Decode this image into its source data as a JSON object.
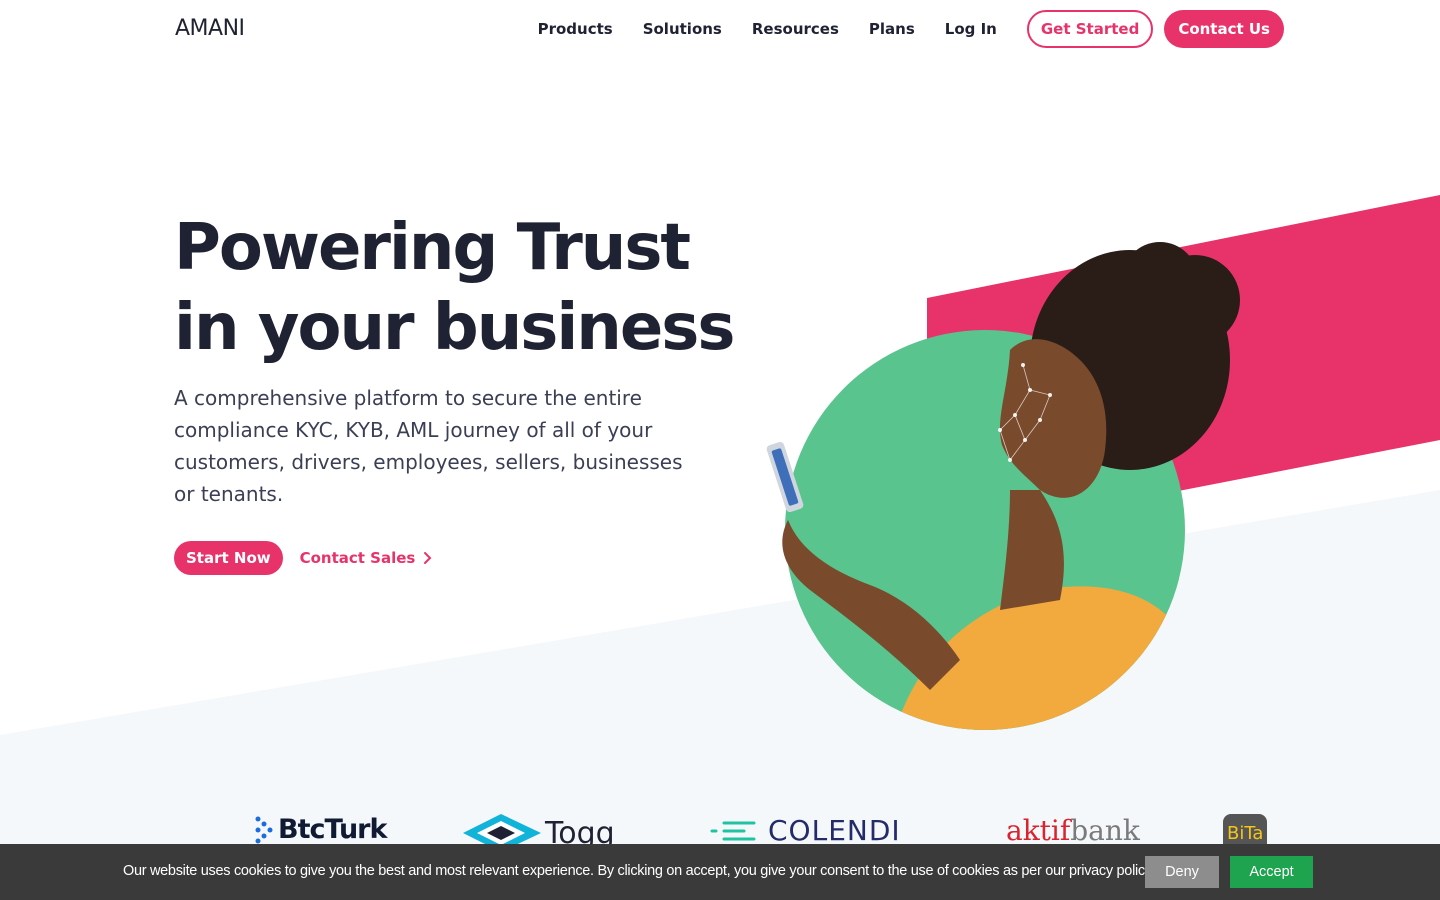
{
  "brand": {
    "logo_text": "AMANI",
    "accent": "#e8336a",
    "green": "#5ac48e"
  },
  "nav": {
    "items": [
      {
        "label": "Products"
      },
      {
        "label": "Solutions"
      },
      {
        "label": "Resources"
      },
      {
        "label": "Plans"
      },
      {
        "label": "Log In"
      }
    ],
    "get_started": "Get Started",
    "contact_us": "Contact Us"
  },
  "hero": {
    "title_line1": "Powering Trust",
    "title_line2": "in your business",
    "description": "A comprehensive platform to secure the entire compliance KYC, KYB, AML journey of all of your customers, drivers, employees, sellers, businesses or tenants.",
    "start_now": "Start Now",
    "contact_sales": "Contact Sales"
  },
  "partners": [
    {
      "name": "BtcTurk"
    },
    {
      "name": "Togg"
    },
    {
      "name": "COLENDI"
    },
    {
      "name_part1": "aktif",
      "name_part2": "bank"
    },
    {
      "name": "BiTa"
    }
  ],
  "cookie": {
    "text": "Our website uses cookies to give you the best and most relevant experience. By clicking on accept, you give your consent to the use of cookies as per our privacy policy.",
    "deny": "Deny",
    "accept": "Accept"
  }
}
